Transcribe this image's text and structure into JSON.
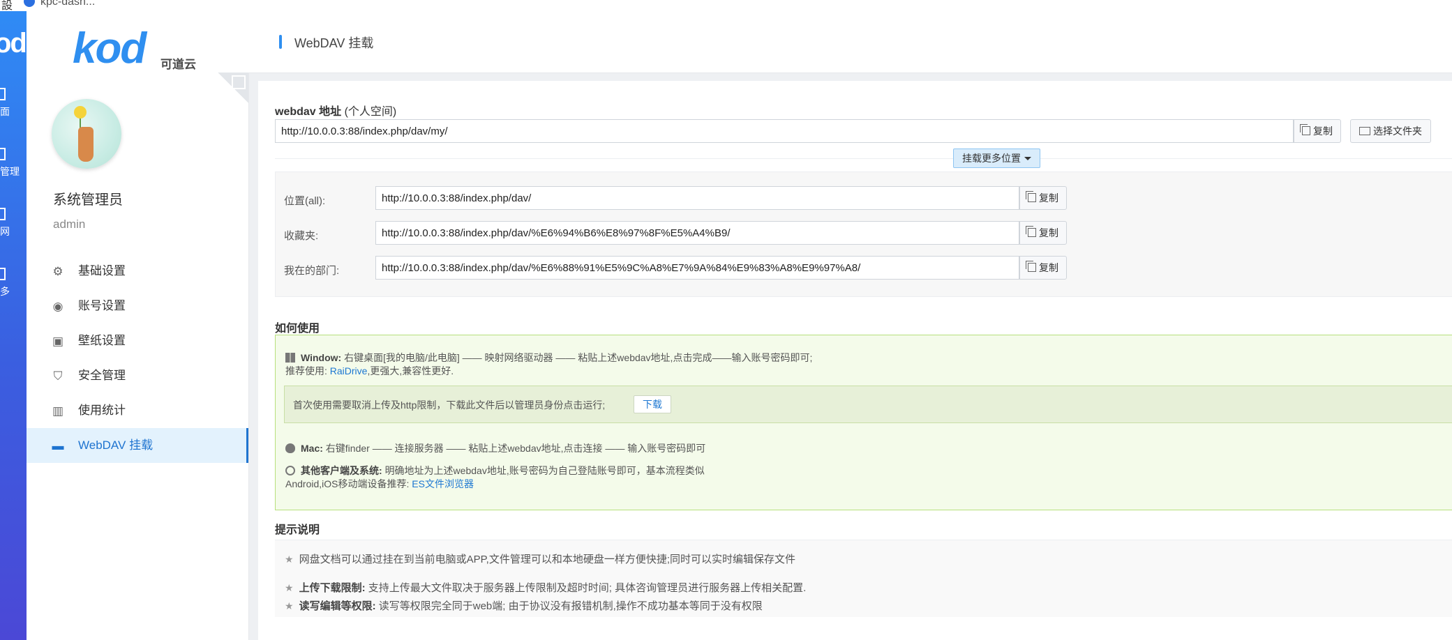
{
  "topbar": {
    "left_text": "設",
    "tab_text": "kpc-dash..."
  },
  "rail": {
    "logo": "od",
    "items": [
      {
        "label": "面"
      },
      {
        "label": "管理"
      },
      {
        "label": "网"
      },
      {
        "label": "多"
      }
    ]
  },
  "brand": {
    "logo_text": "kod",
    "cn_name": "可道云"
  },
  "user": {
    "display_name": "系统管理员",
    "account": "admin"
  },
  "menu": [
    {
      "label": "基础设置",
      "icon": "gear-icon"
    },
    {
      "label": "账号设置",
      "icon": "user-circle-icon"
    },
    {
      "label": "壁纸设置",
      "icon": "image-icon"
    },
    {
      "label": "安全管理",
      "icon": "shield-icon"
    },
    {
      "label": "使用统计",
      "icon": "bar-chart-icon"
    },
    {
      "label": "WebDAV 挂载",
      "icon": "monitor-icon",
      "active": true
    }
  ],
  "header": {
    "title": "WebDAV 挂载"
  },
  "webdav": {
    "address_label": "webdav 地址",
    "address_suffix": "(个人空间)",
    "address_url": "http://10.0.0.3:88/index.php/dav/my/",
    "copy_label": "复制",
    "choose_folder_label": "选择文件夹",
    "more_locations_label": "挂载更多位置"
  },
  "locations": [
    {
      "label": "位置(all):",
      "url": "http://10.0.0.3:88/index.php/dav/"
    },
    {
      "label": "收藏夹:",
      "url": "http://10.0.0.3:88/index.php/dav/%E6%94%B6%E8%97%8F%E5%A4%B9/"
    },
    {
      "label": "我在的部门:",
      "url": "http://10.0.0.3:88/index.php/dav/%E6%88%91%E5%9C%A8%E7%9A%84%E9%83%A8%E9%97%A8/"
    }
  ],
  "howto": {
    "title": "如何使用",
    "windows_label": "Window:",
    "windows_text": "右键桌面[我的电脑/此电脑] —— 映射网络驱动器 —— 粘贴上述webdav地址,点击完成——输入账号密码即可;",
    "recommend_prefix": "推荐使用:",
    "recommend_link": "RaiDrive",
    "recommend_suffix": ",更强大,兼容性更好.",
    "notice_text": "首次使用需要取消上传及http限制，下载此文件后以管理员身份点击运行;",
    "download_label": "下载",
    "mac_label": "Mac:",
    "mac_text": "右键finder —— 连接服务器 —— 粘贴上述webdav地址,点击连接 —— 输入账号密码即可",
    "other_label": "其他客户端及系统:",
    "other_text": "明确地址为上述webdav地址,账号密码为自己登陆账号即可，基本流程类似",
    "mobile_prefix": "Android,iOS移动端设备推荐:",
    "mobile_link": "ES文件浏览器"
  },
  "tips": {
    "title": "提示说明",
    "items": [
      {
        "bold": "",
        "text": "网盘文档可以通过挂在到当前电脑或APP,文件管理可以和本地硬盘一样方便快捷;同时可以实时编辑保存文件"
      },
      {
        "bold": "上传下载限制:",
        "text": "支持上传最大文件取决于服务器上传限制及超时时间; 具体咨询管理员进行服务器上传相关配置."
      },
      {
        "bold": "读写编辑等权限:",
        "text": "读写等权限完全同于web端; 由于协议没有报错机制,操作不成功基本等同于没有权限"
      }
    ]
  },
  "colors": {
    "accent": "#2f8ff0",
    "active_bg": "#e3f2fd",
    "green_bg": "#f4fbea",
    "green_border": "#b7e07d"
  }
}
